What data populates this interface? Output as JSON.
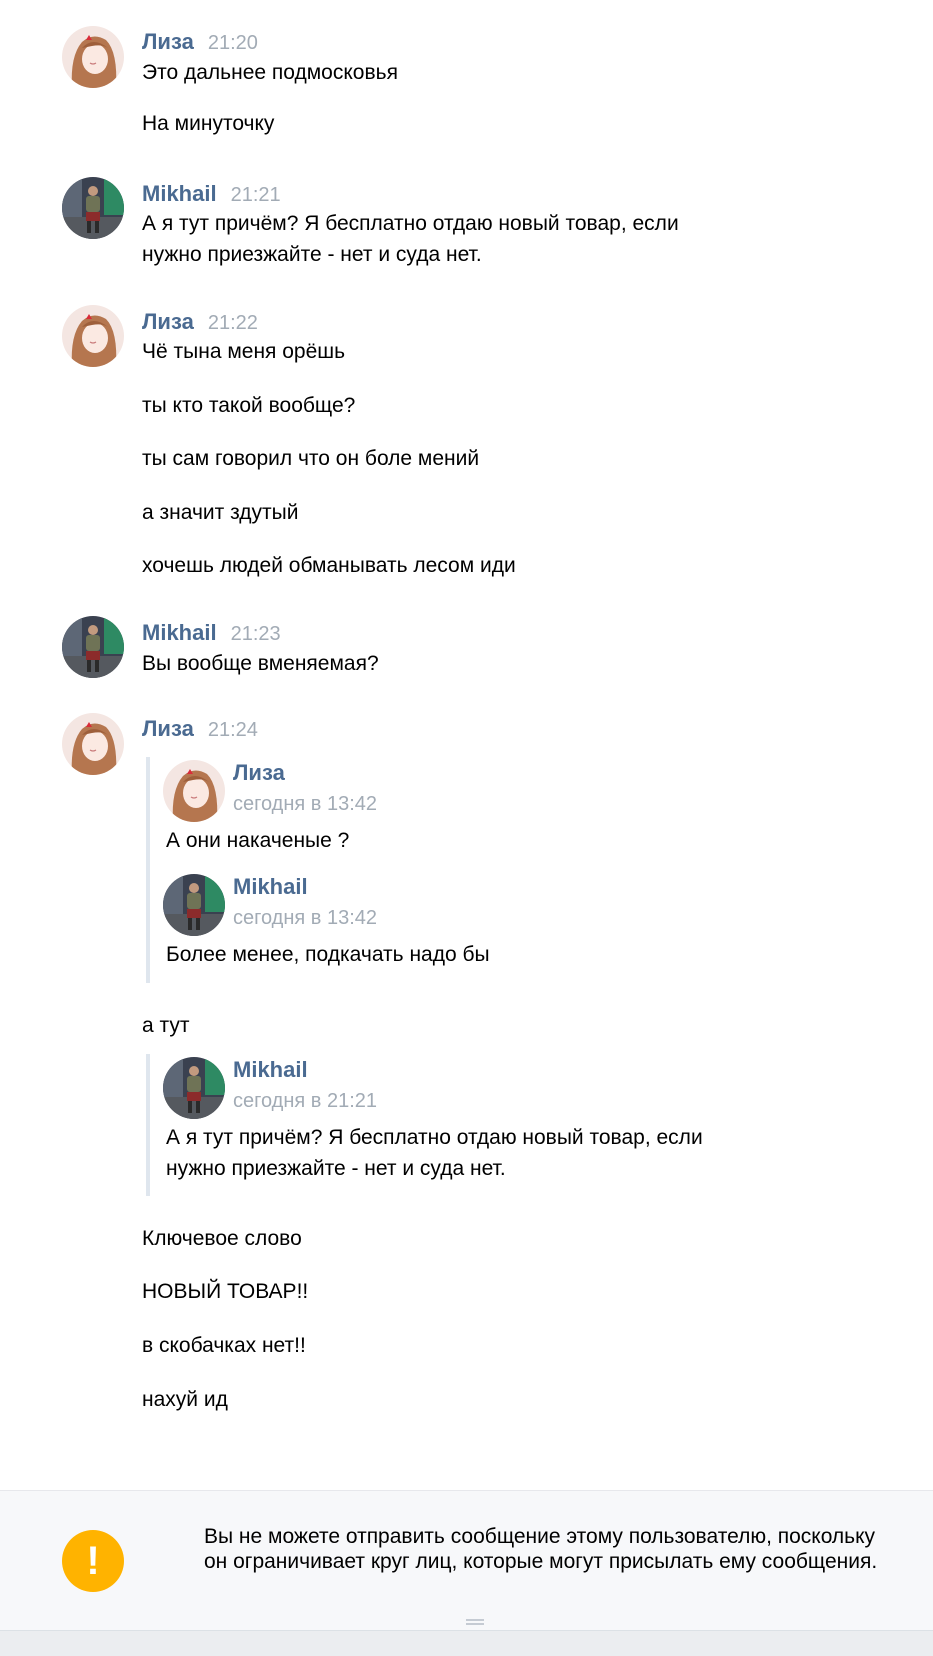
{
  "messages": [
    {
      "author": "Лиза",
      "time": "21:20",
      "lines": [
        "Это дальнее подмосковья",
        "На минуточку"
      ]
    },
    {
      "author": "Mikhail",
      "time": "21:21",
      "lines": [
        "А я тут причём? Я бесплатно отдаю новый товар, если",
        "нужно приезжайте - нет и суда нет."
      ]
    },
    {
      "author": "Лиза",
      "time": "21:22",
      "lines": [
        "Чё тына меня орёшь",
        "ты кто такой вообще?",
        "ты сам говорил что он боле мений",
        "а значит здутый",
        "хочешь людей обманывать лесом иди"
      ]
    },
    {
      "author": "Mikhail",
      "time": "21:23",
      "lines": [
        "Вы вообще вменяемая?"
      ]
    },
    {
      "author": "Лиза",
      "time": "21:24",
      "quote1": [
        {
          "author": "Лиза",
          "date": "сегодня в 13:42",
          "text": "А они накаченые ?"
        },
        {
          "author": "Mikhail",
          "date": "сегодня в 13:42",
          "text": "Более менее, подкачать надо бы"
        }
      ],
      "between": "а тут",
      "quote2": {
        "author": "Mikhail",
        "date": "сегодня в 21:21",
        "lines": [
          "А я тут причём? Я бесплатно отдаю новый товар, если",
          "нужно приезжайте - нет и суда нет."
        ]
      },
      "after": [
        "Ключевое слово",
        "НОВЫЙ ТОВАР!!",
        "в скобачках нет!!",
        "нахуй ид"
      ]
    }
  ],
  "notice": {
    "icon": "exclamation-icon",
    "text": "Вы не можете отправить сообщение этому пользователю, поскольку он ограничивает круг лиц, которые могут присылать ему сообщения."
  },
  "colors": {
    "name": "#4a6a91",
    "time": "#a2abb5",
    "warning": "#ffb300",
    "quote_bar": "#dfe6ee"
  }
}
